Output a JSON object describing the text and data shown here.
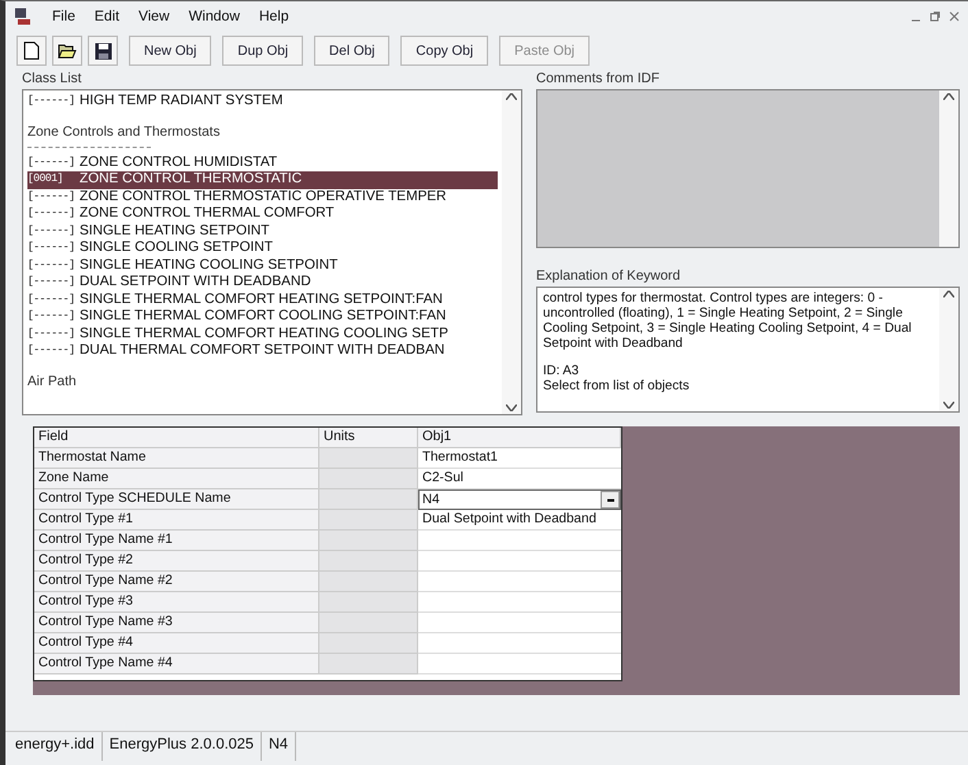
{
  "menu": [
    "File",
    "Edit",
    "View",
    "Window",
    "Help"
  ],
  "toolbar": {
    "buttons": [
      {
        "label": "New Obj",
        "disabled": false
      },
      {
        "label": "Dup Obj",
        "disabled": false
      },
      {
        "label": "Del Obj",
        "disabled": false
      },
      {
        "label": "Copy Obj",
        "disabled": false
      },
      {
        "label": "Paste Obj",
        "disabled": true
      }
    ]
  },
  "class_list": {
    "label": "Class List",
    "items": [
      {
        "kind": "class",
        "count": "[------]",
        "name": "HIGH TEMP RADIANT SYSTEM",
        "selected": false
      },
      {
        "kind": "heading",
        "text": "Zone Controls and Thermostats"
      },
      {
        "kind": "class",
        "count": "[------]",
        "name": "ZONE CONTROL HUMIDISTAT",
        "selected": false
      },
      {
        "kind": "class",
        "count": "[0001]",
        "name": "ZONE CONTROL THERMOSTATIC",
        "selected": true
      },
      {
        "kind": "class",
        "count": "[------]",
        "name": "ZONE CONTROL THERMOSTATIC OPERATIVE TEMPER",
        "selected": false
      },
      {
        "kind": "class",
        "count": "[------]",
        "name": "ZONE CONTROL THERMAL COMFORT",
        "selected": false
      },
      {
        "kind": "class",
        "count": "[------]",
        "name": "SINGLE HEATING SETPOINT",
        "selected": false
      },
      {
        "kind": "class",
        "count": "[------]",
        "name": "SINGLE COOLING SETPOINT",
        "selected": false
      },
      {
        "kind": "class",
        "count": "[------]",
        "name": "SINGLE HEATING COOLING SETPOINT",
        "selected": false
      },
      {
        "kind": "class",
        "count": "[------]",
        "name": "DUAL SETPOINT WITH DEADBAND",
        "selected": false
      },
      {
        "kind": "class",
        "count": "[------]",
        "name": "SINGLE THERMAL COMFORT HEATING SETPOINT:FAN",
        "selected": false
      },
      {
        "kind": "class",
        "count": "[------]",
        "name": "SINGLE THERMAL COMFORT COOLING SETPOINT:FAN",
        "selected": false
      },
      {
        "kind": "class",
        "count": "[------]",
        "name": "SINGLE THERMAL COMFORT HEATING COOLING SETP",
        "selected": false
      },
      {
        "kind": "class",
        "count": "[------]",
        "name": "DUAL THERMAL COMFORT SETPOINT WITH DEADBAN",
        "selected": false
      },
      {
        "kind": "heading",
        "text": "Air Path"
      }
    ]
  },
  "comments": {
    "label": "Comments from IDF"
  },
  "explanation": {
    "label": "Explanation of Keyword",
    "paragraphs": [
      "control types for thermostat. Control types are integers: 0 - uncontrolled (floating), 1 = Single Heating Setpoint, 2 = Single Cooling Setpoint, 3 = Single Heating Cooling Setpoint, 4 = Dual Setpoint with Deadband",
      "ID: A3",
      "Select from list of objects"
    ]
  },
  "grid": {
    "columns": [
      "Field",
      "Units",
      "Obj1"
    ],
    "rows": [
      {
        "field": "Thermostat Name",
        "units": "",
        "value": "Thermostat1",
        "kind": "text"
      },
      {
        "field": "Zone Name",
        "units": "",
        "value": "C2-Sul",
        "kind": "text"
      },
      {
        "field": "Control Type SCHEDULE Name",
        "units": "",
        "value": "N4",
        "kind": "dropdown"
      },
      {
        "field": "Control Type #1",
        "units": "",
        "value": "Dual Setpoint with Deadband",
        "kind": "text"
      },
      {
        "field": "Control Type Name #1",
        "units": "",
        "value": "",
        "kind": "text"
      },
      {
        "field": "Control Type #2",
        "units": "",
        "value": "",
        "kind": "text"
      },
      {
        "field": "Control Type Name #2",
        "units": "",
        "value": "",
        "kind": "text"
      },
      {
        "field": "Control Type #3",
        "units": "",
        "value": "",
        "kind": "text"
      },
      {
        "field": "Control Type Name #3",
        "units": "",
        "value": "",
        "kind": "text"
      },
      {
        "field": "Control Type #4",
        "units": "",
        "value": "",
        "kind": "text"
      },
      {
        "field": "Control Type Name #4",
        "units": "",
        "value": "",
        "kind": "text"
      }
    ]
  },
  "status_bar": [
    "energy+.idd",
    "EnergyPlus 2.0.0.025",
    "N4"
  ]
}
